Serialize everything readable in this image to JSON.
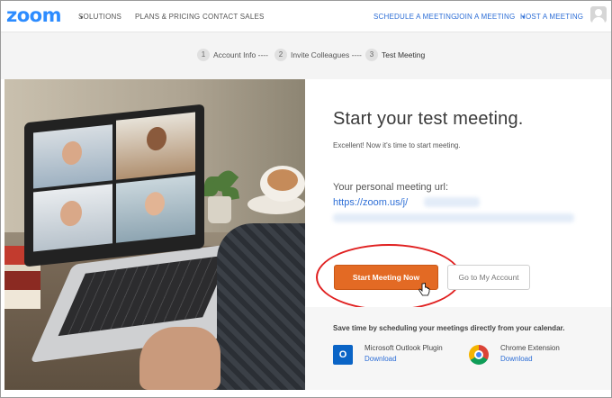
{
  "header": {
    "logo": "zoom",
    "nav_left": [
      {
        "label": "SOLUTIONS",
        "caret": "▾"
      },
      {
        "label": "PLANS & PRICING"
      },
      {
        "label": "CONTACT SALES"
      }
    ],
    "nav_right": [
      {
        "label": "SCHEDULE A MEETING"
      },
      {
        "label": "JOIN A MEETING"
      },
      {
        "label": "HOST A MEETING",
        "caret": "▾"
      }
    ],
    "avatar_icon": "user-avatar-icon"
  },
  "steps": [
    {
      "num": "1",
      "label": "Account Info ----"
    },
    {
      "num": "2",
      "label": "Invite Colleagues ----"
    },
    {
      "num": "3",
      "label": "Test Meeting"
    }
  ],
  "main": {
    "title": "Start your test meeting.",
    "subtitle": "Excellent! Now it's time to start meeting.",
    "url_label": "Your personal meeting url:",
    "url_value": "https://zoom.us/j/",
    "start_button": "Start Meeting Now",
    "account_button": "Go to My Account"
  },
  "calendar": {
    "text": "Save time by scheduling your meetings directly from your calendar.",
    "plugins": [
      {
        "name": "Microsoft Outlook Plugin",
        "link": "Download",
        "icon": "outlook-icon",
        "icon_glyph": "O"
      },
      {
        "name": "Chrome Extension",
        "link": "Download",
        "icon": "chrome-icon"
      }
    ]
  },
  "colors": {
    "brand": "#2d8cff",
    "link": "#2d6ed6",
    "start_button": "#e36a24",
    "annotation_oval": "#e02020"
  }
}
